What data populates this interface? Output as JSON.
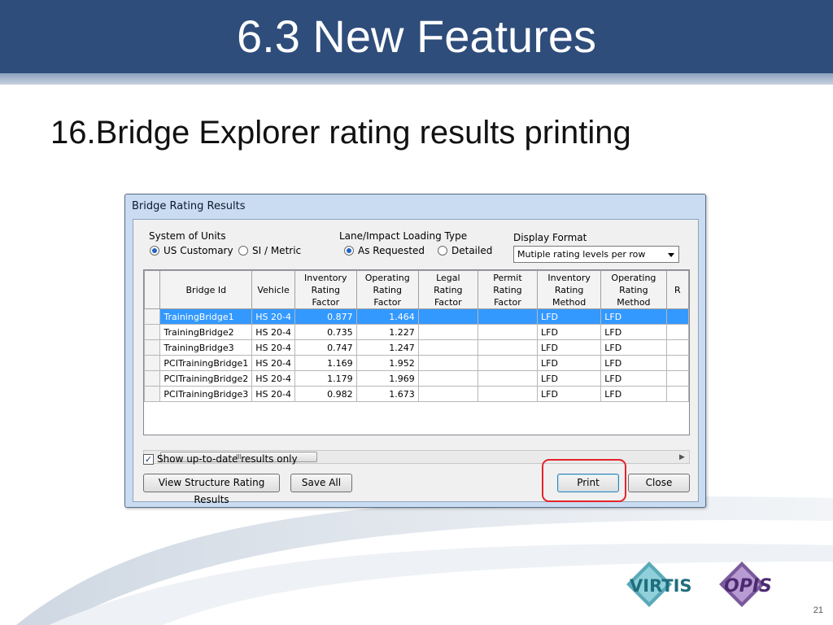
{
  "slide": {
    "title": "6.3 New Features",
    "subtitle": "16.Bridge Explorer rating results printing",
    "page_number": "21"
  },
  "dialog": {
    "title": "Bridge Rating Results",
    "units": {
      "label": "System of Units",
      "options": [
        {
          "label": "US Customary",
          "selected": true
        },
        {
          "label": "SI / Metric",
          "selected": false
        }
      ]
    },
    "loading": {
      "label": "Lane/Impact Loading Type",
      "options": [
        {
          "label": "As Requested",
          "selected": true
        },
        {
          "label": "Detailed",
          "selected": false
        }
      ]
    },
    "display_format": {
      "label": "Display Format",
      "value": "Mutiple rating levels per row"
    },
    "grid": {
      "columns": [
        "Bridge Id",
        "Vehicle",
        "Inventory Rating Factor",
        "Operating Rating Factor",
        "Legal Rating Factor",
        "Permit Rating Factor",
        "Inventory Rating Method",
        "Operating Rating Method",
        "R"
      ],
      "rows": [
        [
          "TrainingBridge1",
          "HS 20-4",
          "0.877",
          "1.464",
          "",
          "",
          "LFD",
          "LFD",
          ""
        ],
        [
          "TrainingBridge2",
          "HS 20-4",
          "0.735",
          "1.227",
          "",
          "",
          "LFD",
          "LFD",
          ""
        ],
        [
          "TrainingBridge3",
          "HS 20-4",
          "0.747",
          "1.247",
          "",
          "",
          "LFD",
          "LFD",
          ""
        ],
        [
          "PCITrainingBridge1",
          "HS 20-4",
          "1.169",
          "1.952",
          "",
          "",
          "LFD",
          "LFD",
          ""
        ],
        [
          "PCITrainingBridge2",
          "HS 20-4",
          "1.179",
          "1.969",
          "",
          "",
          "LFD",
          "LFD",
          ""
        ],
        [
          "PCITrainingBridge3",
          "HS 20-4",
          "0.982",
          "1.673",
          "",
          "",
          "LFD",
          "LFD",
          ""
        ]
      ],
      "selected_row": 0,
      "scroll_thumb_grip": "III"
    },
    "show_uptodate": {
      "label": "Show up-to-date results only",
      "checked": true
    },
    "buttons": {
      "view_structure": "View Structure Rating Results",
      "save_all": "Save All",
      "print": "Print",
      "close": "Close"
    }
  },
  "logos": {
    "virtis": "VIRTIS",
    "opis": "OPIS"
  },
  "colors": {
    "title_bar": "#2e4d7b",
    "selection": "#3399ff",
    "highlight": "#e3242b"
  }
}
